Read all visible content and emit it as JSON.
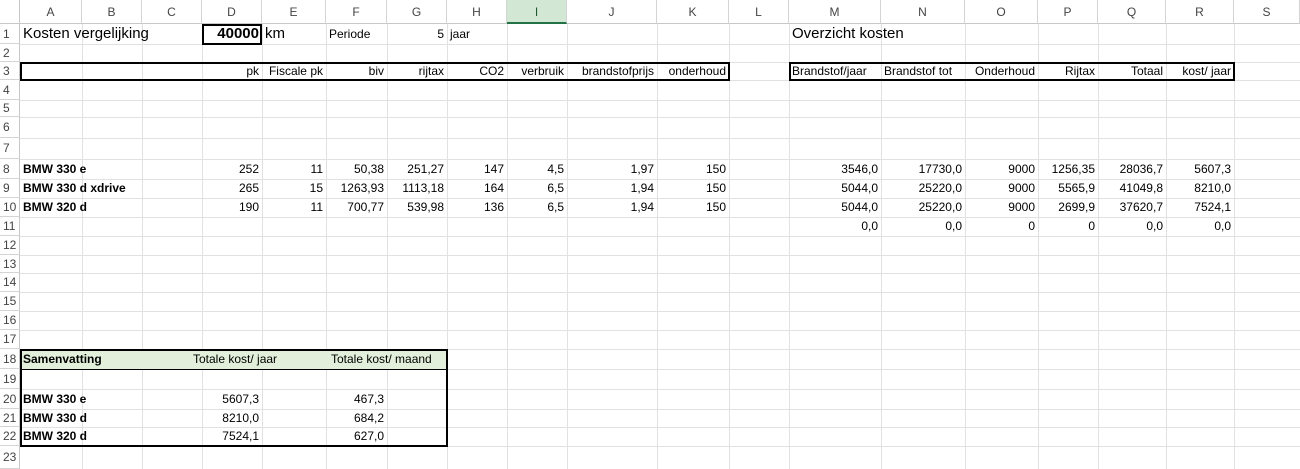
{
  "columns": [
    "A",
    "B",
    "C",
    "D",
    "E",
    "F",
    "G",
    "H",
    "I",
    "J",
    "K",
    "L",
    "M",
    "N",
    "O",
    "P",
    "Q",
    "R",
    "S"
  ],
  "rows": [
    "1",
    "2",
    "3",
    "4",
    "5",
    "6",
    "7",
    "8",
    "9",
    "10",
    "11",
    "12",
    "13",
    "14",
    "15",
    "16",
    "17",
    "18",
    "19",
    "20",
    "21",
    "22",
    "23"
  ],
  "selected_column": "I",
  "header": {
    "title": "Kosten vergelijking",
    "distance": "40000",
    "distance_unit": "km",
    "period_label": "Periode",
    "period_value": "5",
    "period_unit": "jaar",
    "overview_title": "Overzicht kosten"
  },
  "left_table": {
    "headers": [
      "pk",
      "Fiscale pk",
      "biv",
      "rijtax",
      "CO2",
      "verbruik",
      "brandstofprijs",
      "onderhoud"
    ],
    "rows": [
      {
        "name": "BMW 330 e",
        "values": [
          "252",
          "11",
          "50,38",
          "251,27",
          "147",
          "4,5",
          "1,97",
          "150"
        ]
      },
      {
        "name": "BMW 330 d xdrive",
        "values": [
          "265",
          "15",
          "1263,93",
          "1113,18",
          "164",
          "6,5",
          "1,94",
          "150"
        ]
      },
      {
        "name": "BMW 320 d",
        "values": [
          "190",
          "11",
          "700,77",
          "539,98",
          "136",
          "6,5",
          "1,94",
          "150"
        ]
      }
    ]
  },
  "right_table": {
    "headers": [
      "Brandstof/jaar",
      "Brandstof tot",
      "Onderhoud",
      "Rijtax",
      "Totaal",
      "kost/ jaar"
    ],
    "rows": [
      [
        "3546,0",
        "17730,0",
        "9000",
        "1256,35",
        "28036,7",
        "5607,3"
      ],
      [
        "5044,0",
        "25220,0",
        "9000",
        "5565,9",
        "41049,8",
        "8210,0"
      ],
      [
        "5044,0",
        "25220,0",
        "9000",
        "2699,9",
        "37620,7",
        "7524,1"
      ],
      [
        "0,0",
        "0,0",
        "0",
        "0",
        "0,0",
        "0,0"
      ]
    ]
  },
  "summary": {
    "title": "Samenvatting",
    "headers": [
      "Totale kost/ jaar",
      "Totale kost/ maand"
    ],
    "rows": [
      {
        "name": "BMW 330 e",
        "values": [
          "5607,3",
          "467,3"
        ]
      },
      {
        "name": "BMW 330 d",
        "values": [
          "8210,0",
          "684,2"
        ]
      },
      {
        "name": "BMW 320 d",
        "values": [
          "7524,1",
          "627,0"
        ]
      }
    ],
    "header_fill": "#e2efda"
  },
  "colors": {
    "selected_header_fill": "#d3e7d5",
    "selected_header_accent": "#217346",
    "gridline": "#e1e1e1"
  }
}
